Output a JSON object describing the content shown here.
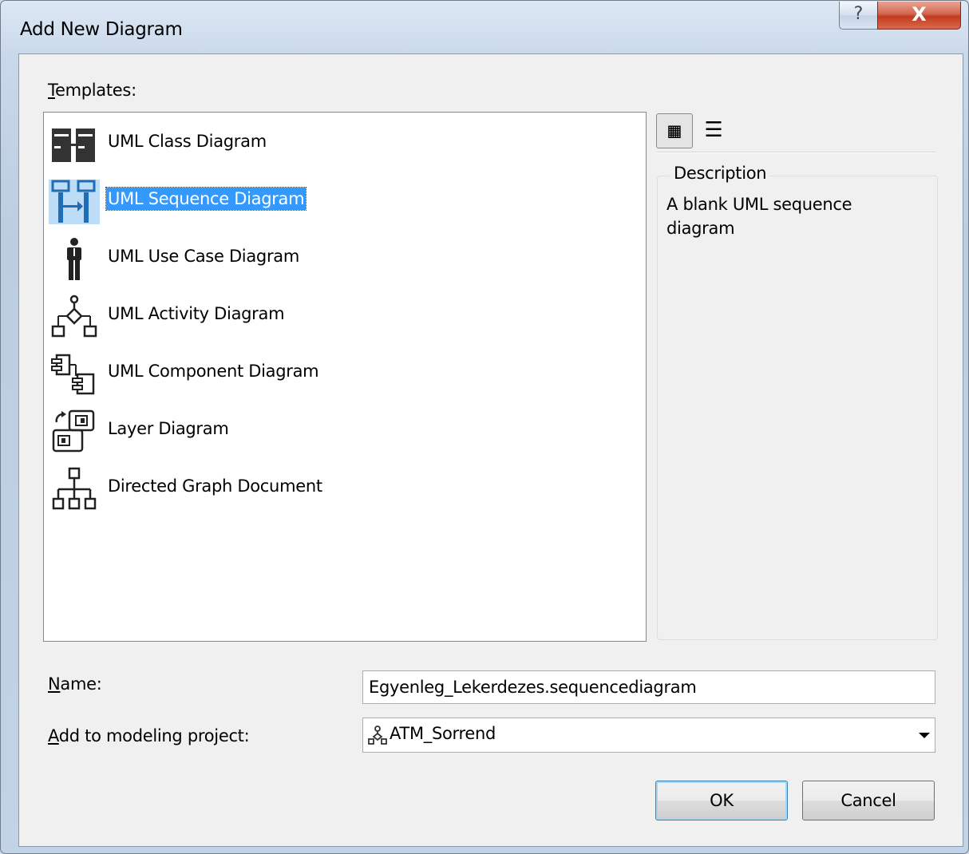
{
  "window": {
    "title": "Add New Diagram",
    "help_glyph": "?",
    "close_glyph": "X"
  },
  "templates": {
    "label": "Templates:",
    "items": [
      {
        "label": "UML Class Diagram",
        "icon": "class-diagram-icon"
      },
      {
        "label": "UML Sequence Diagram",
        "icon": "sequence-diagram-icon",
        "selected": true
      },
      {
        "label": "UML Use Case Diagram",
        "icon": "use-case-diagram-icon"
      },
      {
        "label": "UML Activity Diagram",
        "icon": "activity-diagram-icon"
      },
      {
        "label": "UML Component Diagram",
        "icon": "component-diagram-icon"
      },
      {
        "label": "Layer Diagram",
        "icon": "layer-diagram-icon"
      },
      {
        "label": "Directed Graph Document",
        "icon": "directed-graph-icon"
      }
    ]
  },
  "view": {
    "large_icons_glyph": "▦",
    "list_glyph": "☰"
  },
  "description": {
    "legend": "Description",
    "text": "A blank UML sequence diagram"
  },
  "name": {
    "label": "Name:",
    "value": "Egyenleg_Lekerdezes.sequencediagram"
  },
  "project": {
    "label": "Add to modeling project:",
    "value": "ATM_Sorrend"
  },
  "buttons": {
    "ok": "OK",
    "cancel": "Cancel"
  },
  "colors": {
    "selection": "#3399ff",
    "close_button": "#c23b1f",
    "dialog_bg": "#f0f0f0"
  }
}
